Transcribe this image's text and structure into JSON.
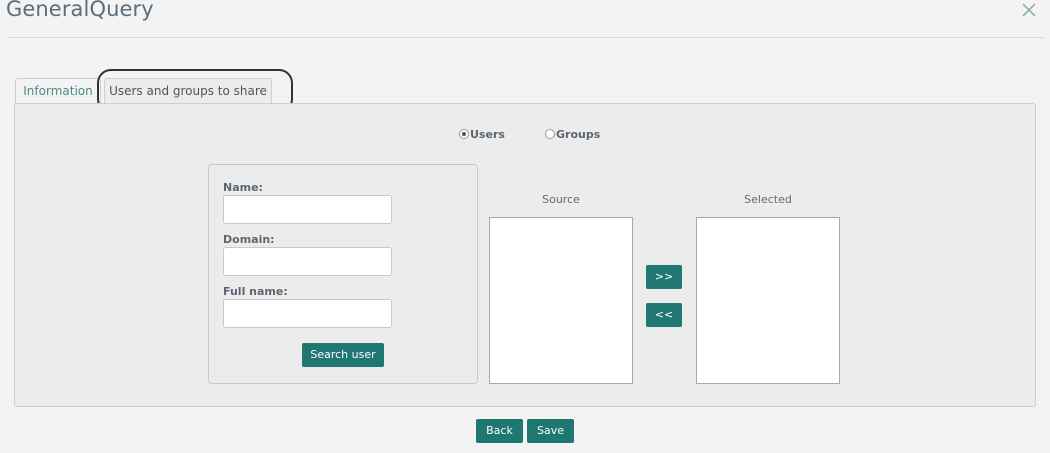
{
  "header": {
    "title": "GeneralQuery",
    "close_icon": "close-icon"
  },
  "tabs": [
    {
      "label": "Information",
      "active": false
    },
    {
      "label": "Users and groups to share",
      "active": true
    }
  ],
  "type_selector": {
    "users_label": "Users",
    "groups_label": "Groups",
    "selected": "Users"
  },
  "search": {
    "name_label": "Name:",
    "name_value": "",
    "domain_label": "Domain:",
    "domain_value": "",
    "fullname_label": "Full name:",
    "fullname_value": "",
    "search_button": "Search user"
  },
  "lists": {
    "source_label": "Source",
    "selected_label": "Selected",
    "source_items": [],
    "selected_items": [],
    "add_button": ">>",
    "remove_button": "<<"
  },
  "footer": {
    "back_button": "Back",
    "save_button": "Save"
  },
  "colors": {
    "accent": "#1f7771",
    "tab_text": "#4a8c85",
    "title": "#5b6d7d"
  }
}
